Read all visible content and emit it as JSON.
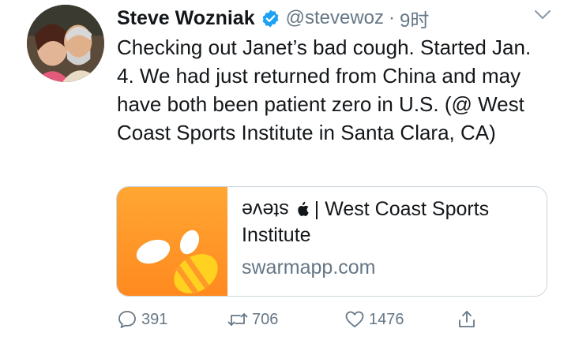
{
  "tweet": {
    "author_name": "Steve Wozniak",
    "handle": "@stevewoz",
    "separator": "·",
    "time": "9时",
    "text": "Checking out Janet’s bad cough. Started Jan. 4. We had just returned from China and may have both been patient zero in U.S. (@ West Coast Sports Institute in Santa Clara, CA)"
  },
  "card": {
    "title_flipped": "steve",
    "title_rest": "| West Coast Sports Institute",
    "domain": "swarmapp.com"
  },
  "actions": {
    "replies": "391",
    "retweets": "706",
    "likes": "1476"
  },
  "icons": {
    "verified": "verified-badge-icon",
    "caret": "chevron-down-icon",
    "reply": "comment-icon",
    "retweet": "retweet-icon",
    "like": "heart-icon",
    "share": "share-icon",
    "apple": "apple-logo-icon"
  },
  "colors": {
    "verified_blue": "#1da1f2",
    "muted": "#657786",
    "swarm_orange": "#ff9a2a"
  }
}
